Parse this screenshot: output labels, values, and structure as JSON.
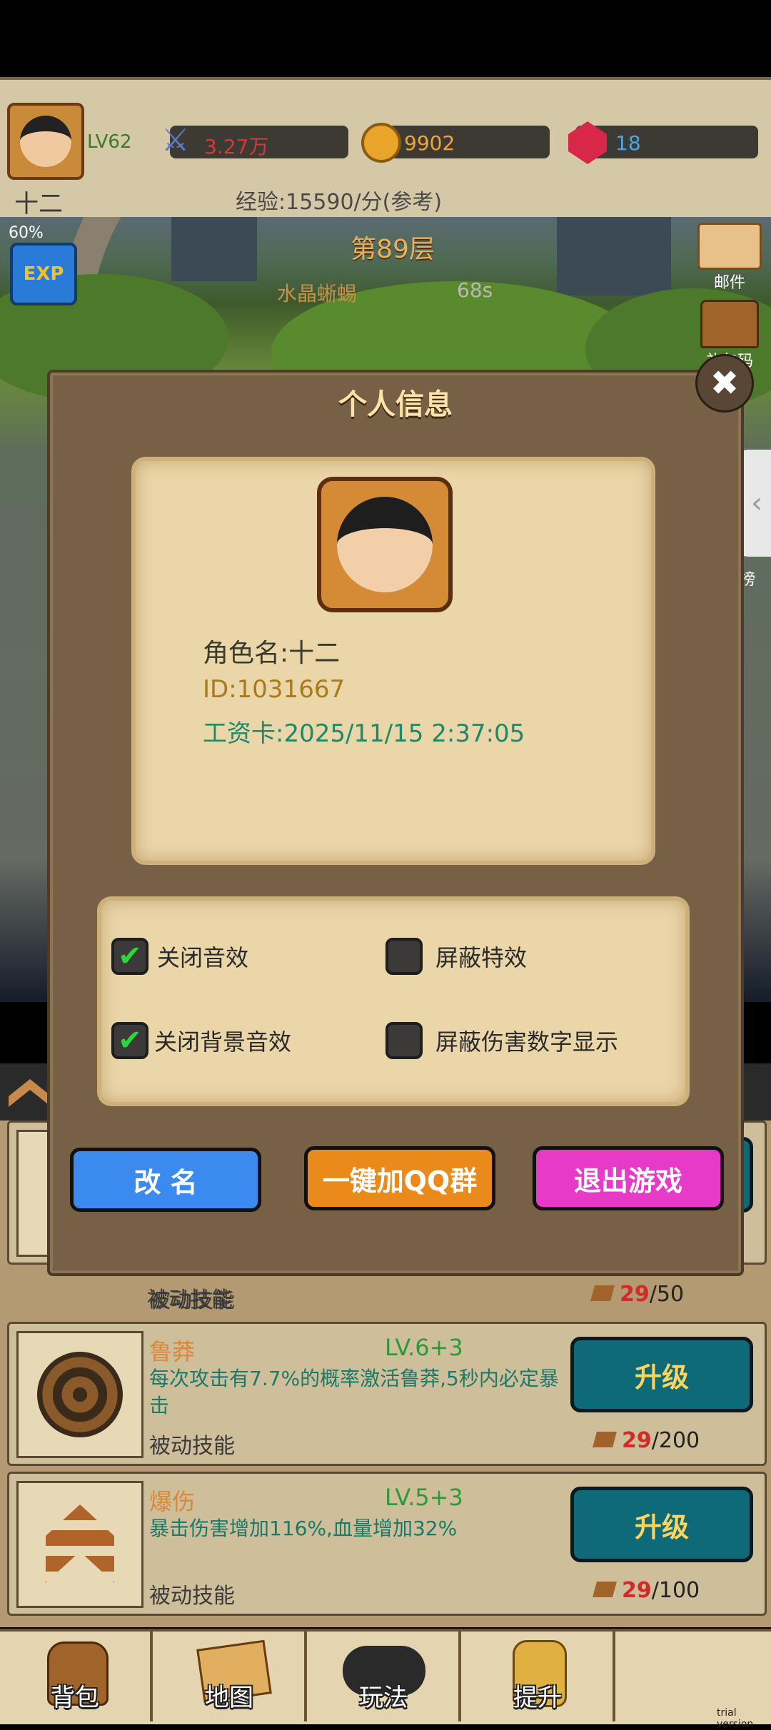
{
  "header": {
    "level": "LV62",
    "power": "3.27万",
    "gold": "9902",
    "gems": "18",
    "player_name": "十二",
    "exp_rate": "经验:15590/分(参考)"
  },
  "scene": {
    "floor": "第89层",
    "enemy": "水晶蜥蜴",
    "timer": "68s",
    "exp_boost": "60%",
    "exp_badge": "EXP",
    "mail": "邮件",
    "gift": "礼包码",
    "rank_partial": "榜"
  },
  "dialog": {
    "title": "个人信息",
    "role_name": "角色名:十二",
    "id": "ID:1031667",
    "salary_card": "工资卡:2025/11/15 2:37:05",
    "options": [
      {
        "label": "关闭音效",
        "checked": true
      },
      {
        "label": "屏蔽特效",
        "checked": false
      },
      {
        "label": "关闭背景音效",
        "checked": true
      },
      {
        "label": "屏蔽伤害数字显示",
        "checked": false
      }
    ],
    "rename": "改 名",
    "join_qq": "一键加QQ群",
    "exit": "退出游戏"
  },
  "skills": [
    {
      "name": "",
      "level": "",
      "desc": "",
      "type": "被动技能",
      "cost_have": "29",
      "cost_need": "/50",
      "button": ""
    },
    {
      "name": "鲁莽",
      "level": "LV.6+3",
      "desc": "每次攻击有7.7%的概率激活鲁莽,5秒内必定暴击",
      "type": "被动技能",
      "cost_have": "29",
      "cost_need": "/200",
      "button": "升级"
    },
    {
      "name": "爆伤",
      "level": "LV.5+3",
      "desc": "暴击伤害增加116%,血量增加32%",
      "type": "被动技能",
      "cost_have": "29",
      "cost_need": "/100",
      "button": "升级"
    }
  ],
  "nav": [
    "背包",
    "地图",
    "玩法",
    "提升",
    ""
  ],
  "watermark": "trial version"
}
